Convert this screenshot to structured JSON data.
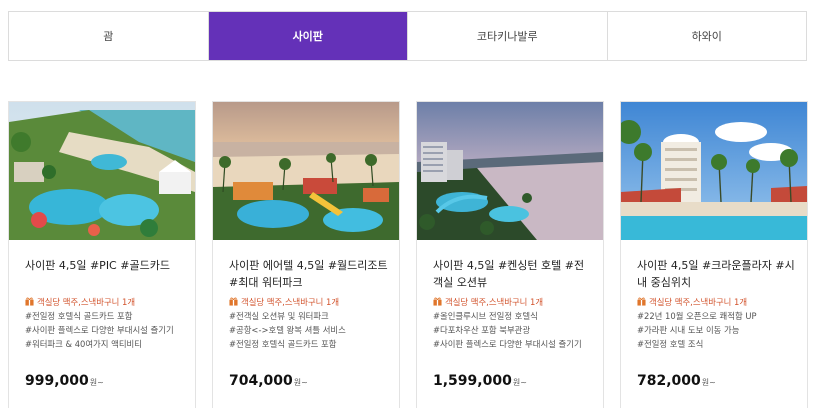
{
  "tabs": [
    {
      "label": "괌",
      "active": false
    },
    {
      "label": "사이판",
      "active": true
    },
    {
      "label": "코타키나발루",
      "active": false
    },
    {
      "label": "하와이",
      "active": false
    }
  ],
  "colors": {
    "accent": "#6431b8",
    "highlight": "#d2532c"
  },
  "cards": [
    {
      "title": "사이판 4,5일 #PIC #골드카드",
      "features": [
        "객실당 맥주,스낵바구니 1개",
        "#전일정 호텔식 골드카드 포함",
        "#사이판 플렉스로 다양한 부대시설 즐기기",
        "#워터파크 & 40여가지 액티비티"
      ],
      "price": "999,000",
      "unit": "원~"
    },
    {
      "title": "사이판 에어텔 4,5일 #월드리조트 #최대 워터파크",
      "features": [
        "객실당 맥주,스낵바구니 1개",
        "#전객실 오션뷰 및 워터파크",
        "#공항<->호텔 왕복 셔틀 서비스",
        "#전일정 호텔식 골드카드 포함"
      ],
      "price": "704,000",
      "unit": "원~"
    },
    {
      "title": "사이판 4,5일 #켄싱턴 호텔 #전객실 오션뷰",
      "features": [
        "객실당 맥주,스낵바구니 1개",
        "#올인클루시브 전일정 호텔식",
        "#다포차우산 포함 북부관광",
        "#사이판 플렉스로 다양한 부대시설 즐기기"
      ],
      "price": "1,599,000",
      "unit": "원~"
    },
    {
      "title": "사이판 4,5일 #크라운플라자 #시내 중심위치",
      "features": [
        "객실당 맥주,스낵바구니 1개",
        "#22년 10월 오픈으로 쾌적함 UP",
        "#가라판 시내 도보 이동 가능",
        "#전일정 호텔 조식"
      ],
      "price": "782,000",
      "unit": "원~"
    }
  ]
}
